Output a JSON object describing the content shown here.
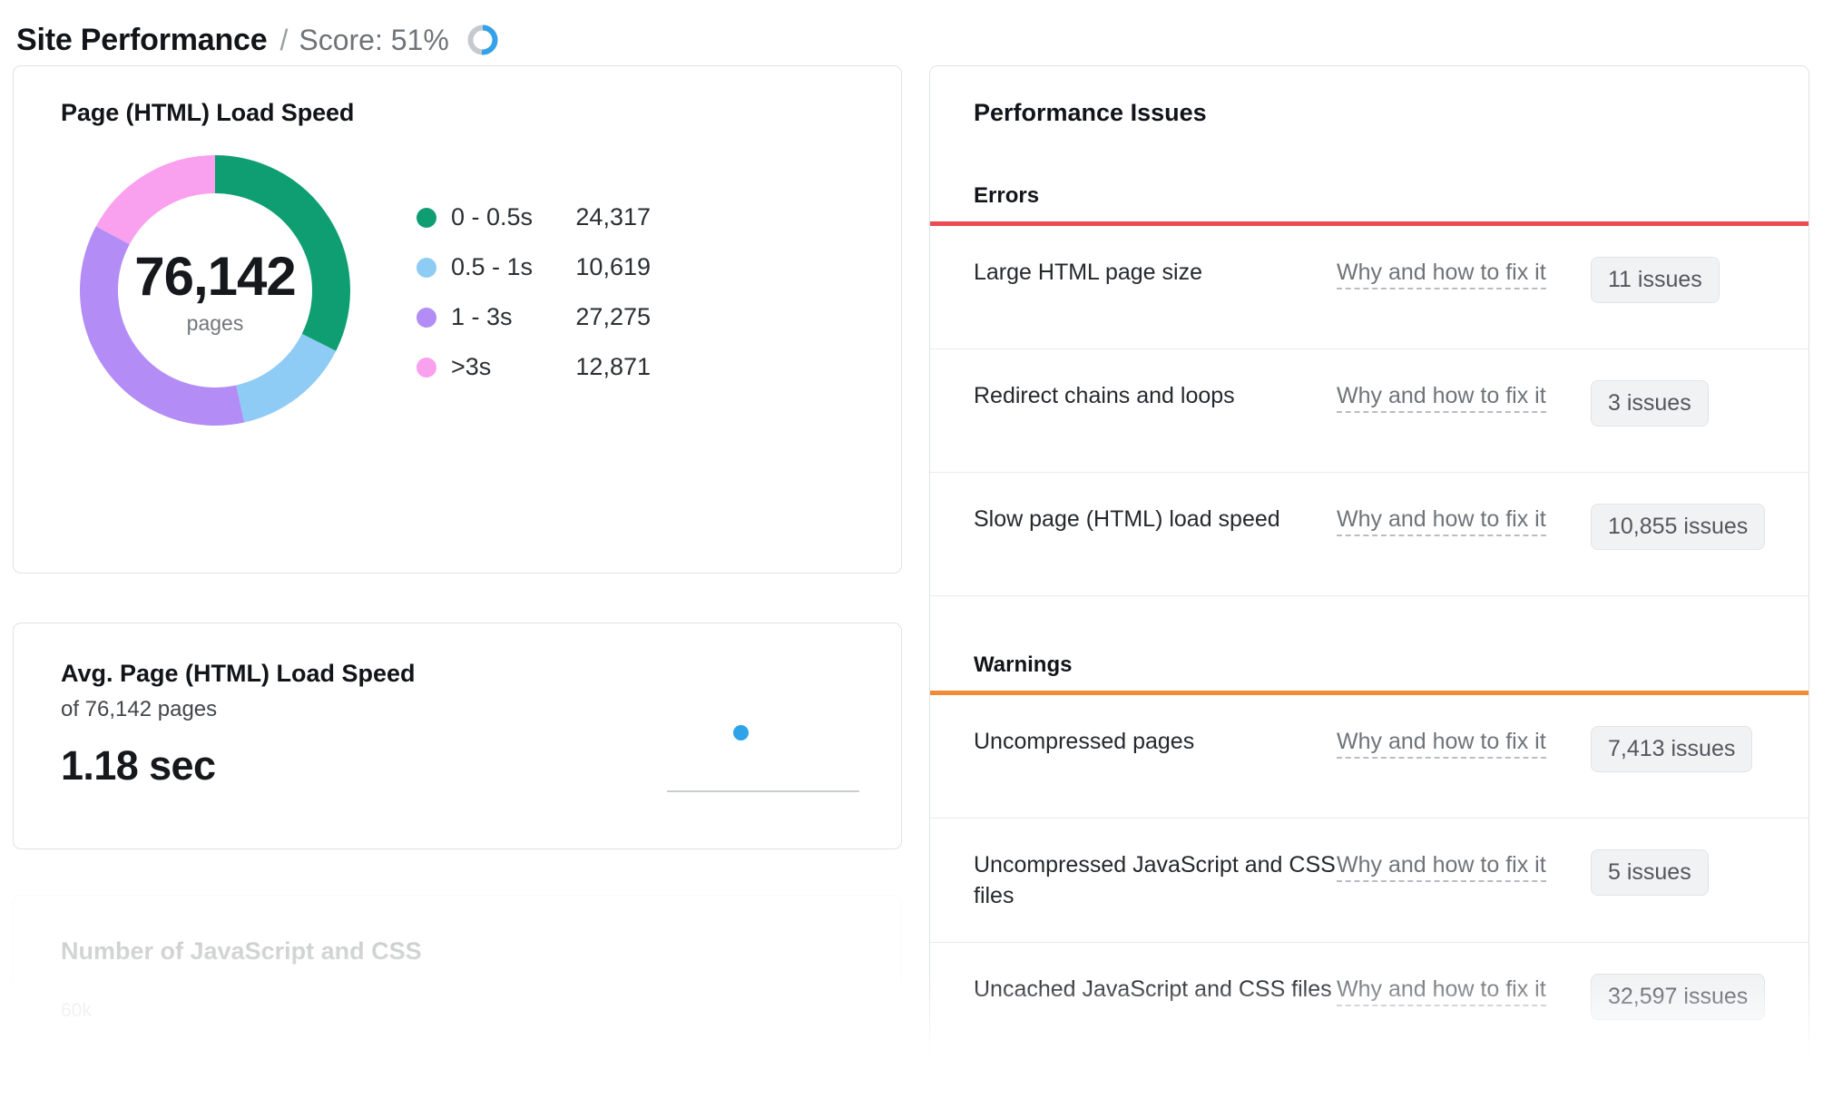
{
  "header": {
    "title": "Site Performance",
    "separator": "/",
    "score_label": "Score: 51%",
    "score_percent": 51,
    "score_ring_color": "#34a1e8",
    "score_ring_track": "#c6cace"
  },
  "load_speed_card": {
    "title": "Page (HTML) Load Speed",
    "total_value": "76,142",
    "total_unit": "pages"
  },
  "chart_data": {
    "type": "pie",
    "title": "Page (HTML) Load Speed",
    "categories": [
      "0 - 0.5s",
      "0.5 - 1s",
      "1 - 3s",
      ">3s"
    ],
    "values": [
      24317,
      10619,
      27275,
      12871
    ],
    "value_labels": [
      "24,317",
      "10,619",
      "27,275",
      "12,871"
    ],
    "colors": [
      "#0f9e72",
      "#8ecbf5",
      "#b38cf5",
      "#f9a0ee"
    ],
    "total": 76142,
    "total_label": "76,142",
    "total_unit": "pages",
    "legend_position": "right",
    "donut": true
  },
  "avg_card": {
    "title": "Avg. Page (HTML) Load Speed",
    "subtitle": "of 76,142 pages",
    "value": "1.18 sec",
    "spark_dot_color": "#2fa3e8"
  },
  "faded_card": {
    "title": "Number of JavaScript and CSS",
    "axis_label": "60k"
  },
  "issues": {
    "title": "Performance Issues",
    "sections": [
      {
        "heading": "Errors",
        "rule_color": "#ef4a52",
        "rows": [
          {
            "name": "Large HTML page size",
            "link": "Why and how to fix it",
            "badge": "11 issues"
          },
          {
            "name": "Redirect chains and loops",
            "link": "Why and how to fix it",
            "badge": "3 issues"
          },
          {
            "name": "Slow page (HTML) load speed",
            "link": "Why and how to fix it",
            "badge": "10,855 issues"
          }
        ]
      },
      {
        "heading": "Warnings",
        "rule_color": "#f28b36",
        "rows": [
          {
            "name": "Uncompressed pages",
            "link": "Why and how to fix it",
            "badge": "7,413 issues"
          },
          {
            "name": "Uncompressed JavaScript and CSS files",
            "link": "Why and how to fix it",
            "badge": "5 issues"
          },
          {
            "name": "Uncached JavaScript and CSS files",
            "link": "Why and how to fix it",
            "badge": "32,597 issues"
          }
        ]
      }
    ]
  }
}
